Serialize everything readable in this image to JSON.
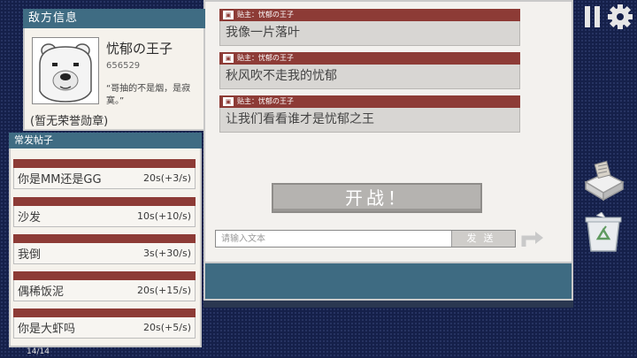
{
  "enemy": {
    "title": "敌方信息",
    "name": "忧郁の王子",
    "id": "656529",
    "signature": "“哥抽的不是烟，是寂寞。”",
    "badge": "(暂无荣誉勋章)"
  },
  "frequent_posts": {
    "title": "常发帖子",
    "items": [
      {
        "text": "你是MM还是GG",
        "time": "20s(+3/s)"
      },
      {
        "text": "沙发",
        "time": "10s(+10/s)"
      },
      {
        "text": "我倒",
        "time": "3s(+30/s)"
      },
      {
        "text": "偶稀饭泥",
        "time": "20s(+15/s)"
      },
      {
        "text": "你是大虾吗",
        "time": "20s(+5/s)"
      }
    ],
    "page_counter": "14/14"
  },
  "thread": {
    "posts": [
      {
        "author": "贴主：忧郁の王子",
        "content": "我像一片落叶"
      },
      {
        "author": "贴主：忧郁の王子",
        "content": "秋风吹不走我的忧郁"
      },
      {
        "author": "贴主：忧郁の王子",
        "content": "让我们看看谁才是忧郁之王"
      }
    ],
    "battle_label": "开战！"
  },
  "composer": {
    "placeholder": "请输入文本",
    "send_label": "发送"
  },
  "icons": [
    "pause-icon",
    "gear-icon",
    "box-icon",
    "recycle-bin-icon",
    "return-arrow-icon"
  ],
  "colors": {
    "background": "#15204a",
    "panel_header": "#3f6c83",
    "post_header": "#8d3b36",
    "panel_bg": "#f5f2ec"
  }
}
